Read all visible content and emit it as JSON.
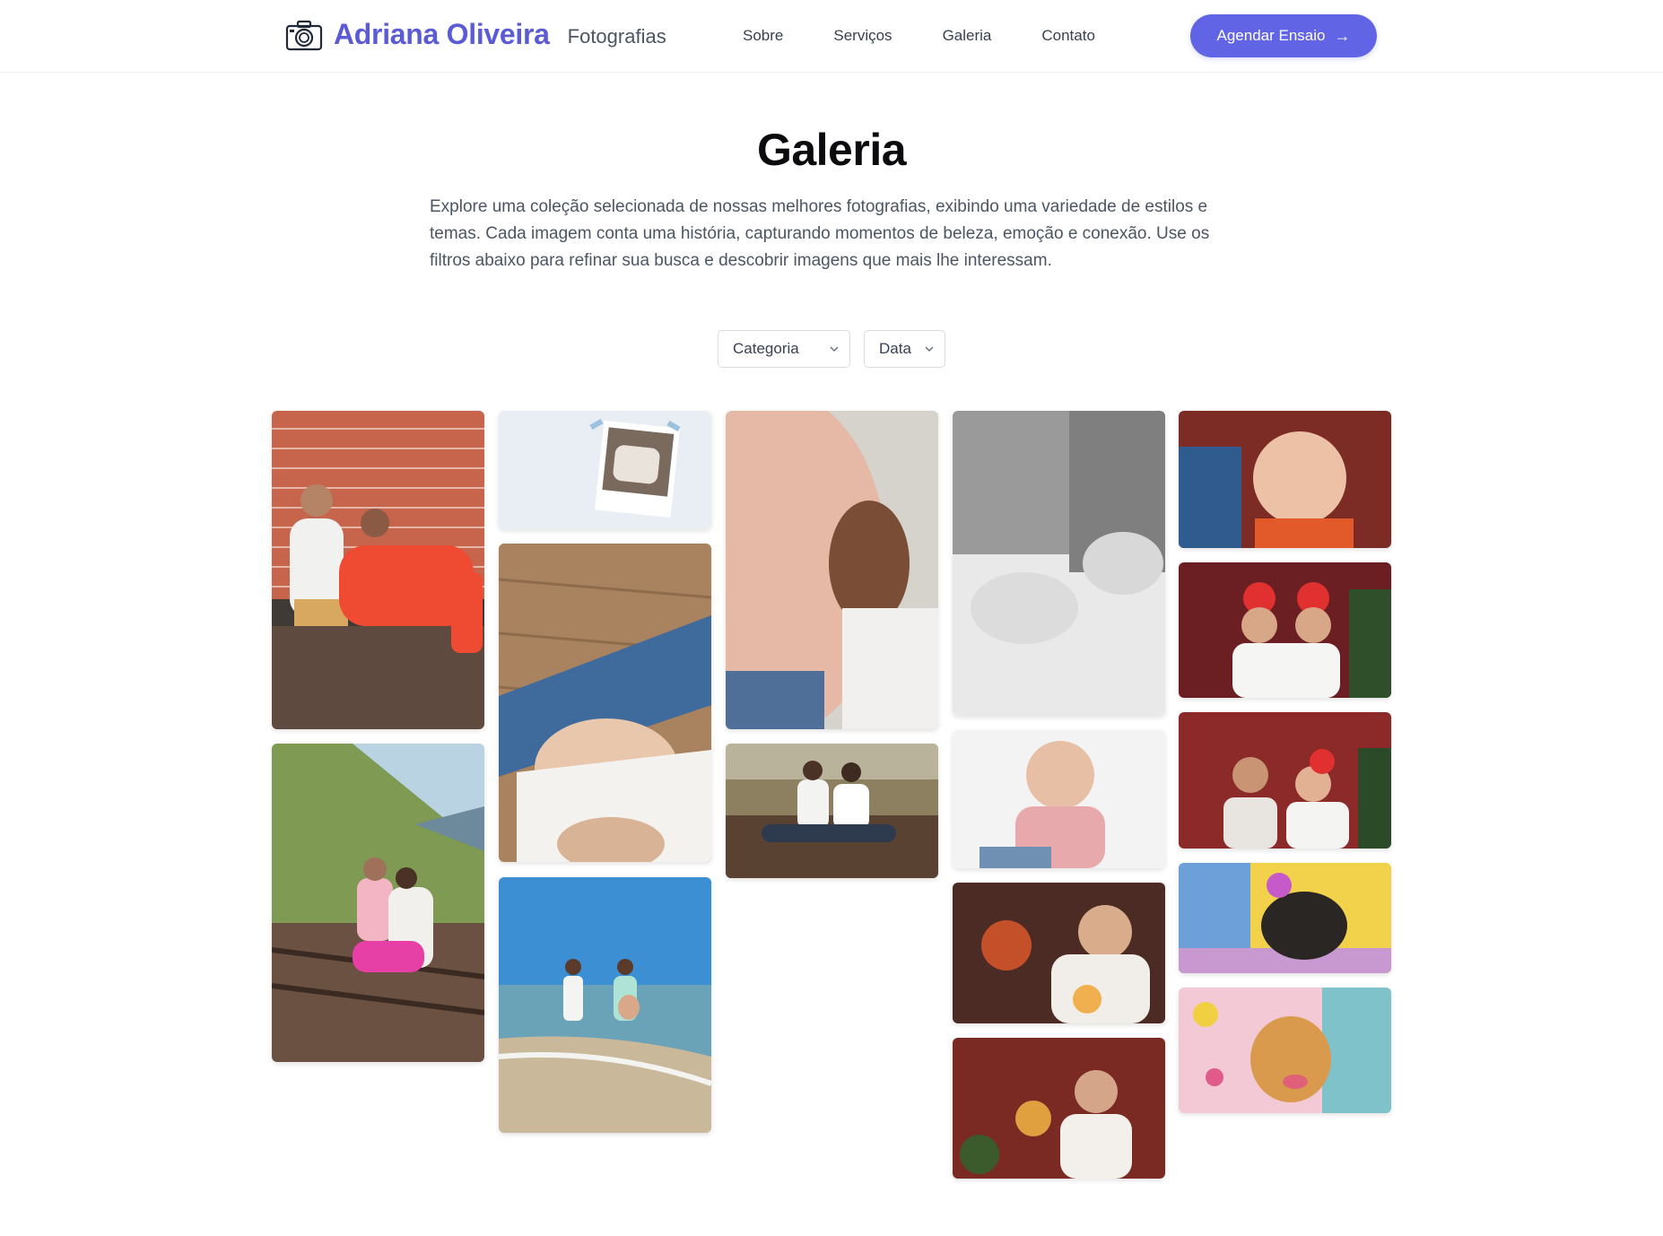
{
  "header": {
    "brand_name": "Adriana Oliveira",
    "brand_sub": "Fotografias",
    "logo_icon": "camera-icon",
    "nav": [
      "Sobre",
      "Serviços",
      "Galeria",
      "Contato"
    ],
    "cta_label": "Agendar Ensaio",
    "cta_icon": "arrow-right-icon"
  },
  "colors": {
    "accent": "#6264e6",
    "brand": "#5b5bd6"
  },
  "page": {
    "title": "Galeria",
    "description": "Explore uma coleção selecionada de nossas melhores fotografias, exibindo uma variedade de estilos e temas. Cada imagem conta uma história, capturando momentos de beleza, emoção e conexão. Use os filtros abaixo para refinar sua busca e descobrir imagens que mais lhe interessam."
  },
  "filters": {
    "category": "Categoria",
    "date": "Data"
  }
}
